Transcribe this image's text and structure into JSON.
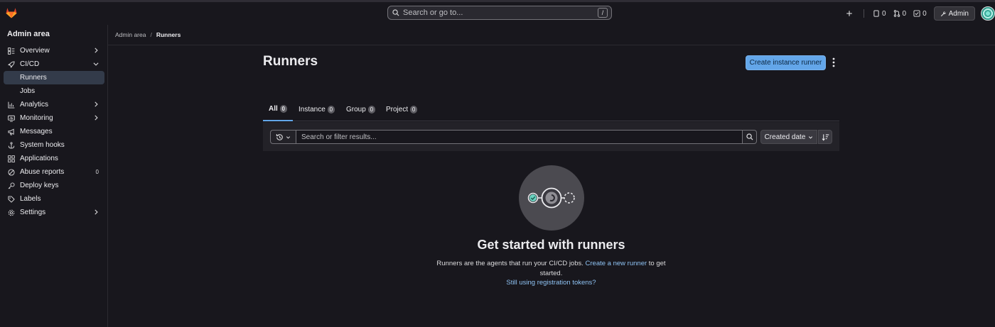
{
  "topbar": {
    "search_placeholder": "Search or go to...",
    "search_shortcut": "/",
    "issues_count": "0",
    "merge_requests_count": "0",
    "todos_count": "0",
    "admin_label": "Admin"
  },
  "sidebar": {
    "title": "Admin area",
    "items": [
      {
        "label": "Overview",
        "icon": "overview-icon",
        "chevron": "right"
      },
      {
        "label": "CI/CD",
        "icon": "rocket-icon",
        "chevron": "down"
      },
      {
        "label": "Runners",
        "sub": true,
        "active": true
      },
      {
        "label": "Jobs",
        "sub": true
      },
      {
        "label": "Analytics",
        "icon": "chart-icon",
        "chevron": "right"
      },
      {
        "label": "Monitoring",
        "icon": "monitor-icon",
        "chevron": "right"
      },
      {
        "label": "Messages",
        "icon": "bullhorn-icon"
      },
      {
        "label": "System hooks",
        "icon": "anchor-icon"
      },
      {
        "label": "Applications",
        "icon": "applications-icon"
      },
      {
        "label": "Abuse reports",
        "icon": "abuse-icon",
        "count": "0"
      },
      {
        "label": "Deploy keys",
        "icon": "key-icon"
      },
      {
        "label": "Labels",
        "icon": "label-icon"
      },
      {
        "label": "Settings",
        "icon": "gear-icon",
        "chevron": "right"
      }
    ]
  },
  "breadcrumb": {
    "parent": "Admin area",
    "current": "Runners"
  },
  "page": {
    "title": "Runners",
    "primary_button": "Create instance runner"
  },
  "tabs": [
    {
      "label": "All",
      "count": "0",
      "active": true
    },
    {
      "label": "Instance",
      "count": "0"
    },
    {
      "label": "Group",
      "count": "0"
    },
    {
      "label": "Project",
      "count": "0"
    }
  ],
  "filter": {
    "placeholder": "Search or filter results...",
    "sort_label": "Created date"
  },
  "empty_state": {
    "title": "Get started with runners",
    "desc_before": "Runners are the agents that run your CI/CD jobs. ",
    "desc_link": "Create a new runner",
    "desc_after": " to get started.",
    "tokens_link": "Still using registration tokens?"
  },
  "colors": {
    "accent": "#63a6e9",
    "link": "#8fc3f4",
    "background": "#18171d",
    "logo": "#e24329"
  }
}
